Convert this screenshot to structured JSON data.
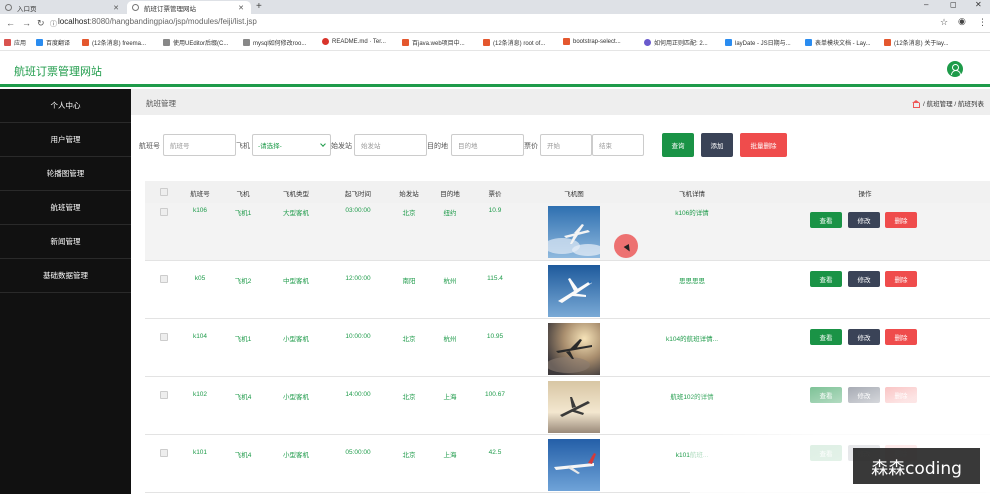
{
  "browser": {
    "tabs": [
      {
        "title": "入口页"
      },
      {
        "title": "航班订票管理网站"
      }
    ],
    "new_tab": "+",
    "window_controls": [
      "–",
      "◻",
      "✕"
    ],
    "nav_icons": [
      "back-arrow-icon",
      "forward-arrow-icon",
      "reload-icon"
    ],
    "url_host": "localhost",
    "url_path": ":8080/hangbandingpiao/jsp/modules/feiji/list.jsp",
    "bookmarks": [
      {
        "label": "应用",
        "color": "#d9534f"
      },
      {
        "label": "百度翻译",
        "color": "#2a8cf0"
      },
      {
        "label": "(12条消息) freema...",
        "color": "#e4572e"
      },
      {
        "label": "使用UEditor后缀(C...",
        "color": "#888888"
      },
      {
        "label": "mysql如何修改roo...",
        "color": "#888888"
      },
      {
        "label": "README.md · Ter...",
        "color": "#d9342b"
      },
      {
        "label": "百java.web项目中...",
        "color": "#e4572e"
      },
      {
        "label": "(12条消息) root of...",
        "color": "#e4572e"
      },
      {
        "label": "bootstrap-select...",
        "color": "#e4572e"
      },
      {
        "label": "如何用正则匹配: 2...",
        "color": "#6a5acd"
      },
      {
        "label": "layDate - JS日期与...",
        "color": "#2a8cf0"
      },
      {
        "label": "表单模块文档 - Lay...",
        "color": "#2a8cf0"
      },
      {
        "label": "(12条消息) 关于lay...",
        "color": "#e4572e"
      }
    ]
  },
  "header": {
    "brand": "航班订票管理网站"
  },
  "sidebar": {
    "items": [
      {
        "label": "个人中心"
      },
      {
        "label": "用户管理"
      },
      {
        "label": "轮播图管理"
      },
      {
        "label": "航班管理"
      },
      {
        "label": "新闻管理"
      },
      {
        "label": "基础数据管理"
      }
    ]
  },
  "breadcrumb": {
    "title": "航班管理",
    "path": "/ 航班管理 / 航班列表"
  },
  "filters": {
    "flight_no_label": "航班号",
    "flight_no_placeholder": "航班号",
    "plane_label": "飞机",
    "plane_select": "-请选择-",
    "origin_label": "始发站",
    "origin_placeholder": "始发站",
    "dest_label": "目的地",
    "dest_placeholder": "目的地",
    "price_label": "票价",
    "price_start_placeholder": "开始",
    "price_end_placeholder": "结束",
    "search_btn": "查询",
    "add_btn": "添加",
    "batch_delete_btn": "批量删除"
  },
  "table": {
    "headers": [
      "航班号",
      "飞机",
      "飞机类型",
      "起飞时间",
      "始发站",
      "目的地",
      "票价",
      "飞机图",
      "飞机详情",
      "操作"
    ],
    "rows": [
      {
        "flight_no": "k106",
        "plane": "飞机1",
        "type": "大型客机",
        "time": "03:00:00",
        "origin": "北京",
        "dest": "纽约",
        "price": "10.9",
        "detail": "k106的详情",
        "image": "sky-a"
      },
      {
        "flight_no": "k05",
        "plane": "飞机2",
        "type": "中型客机",
        "time": "12:00:00",
        "origin": "南阳",
        "dest": "杭州",
        "price": "115.4",
        "detail": "思思思思",
        "image": "sky-b"
      },
      {
        "flight_no": "k104",
        "plane": "飞机1",
        "type": "小型客机",
        "time": "10:00:00",
        "origin": "北京",
        "dest": "杭州",
        "price": "10.95",
        "detail": "k104的航班详情...",
        "image": "sunset-a"
      },
      {
        "flight_no": "k102",
        "plane": "飞机4",
        "type": "小型客机",
        "time": "14:00:00",
        "origin": "北京",
        "dest": "上海",
        "price": "100.67",
        "detail": "航班102的详情",
        "image": "sunset-b"
      },
      {
        "flight_no": "k101",
        "plane": "飞机4",
        "type": "小型客机",
        "time": "05:00:00",
        "origin": "北京",
        "dest": "上海",
        "price": "42.5",
        "detail": "k101航班...",
        "image": "sky-c"
      }
    ],
    "actions": {
      "view": "查看",
      "edit": "修改",
      "delete": "删除"
    }
  },
  "watermark": "森森coding",
  "colors": {
    "brand_green": "#1e9b4a",
    "button_dark": "#3a4357",
    "button_red": "#ef4c4c",
    "sidebar_bg": "#111111"
  }
}
